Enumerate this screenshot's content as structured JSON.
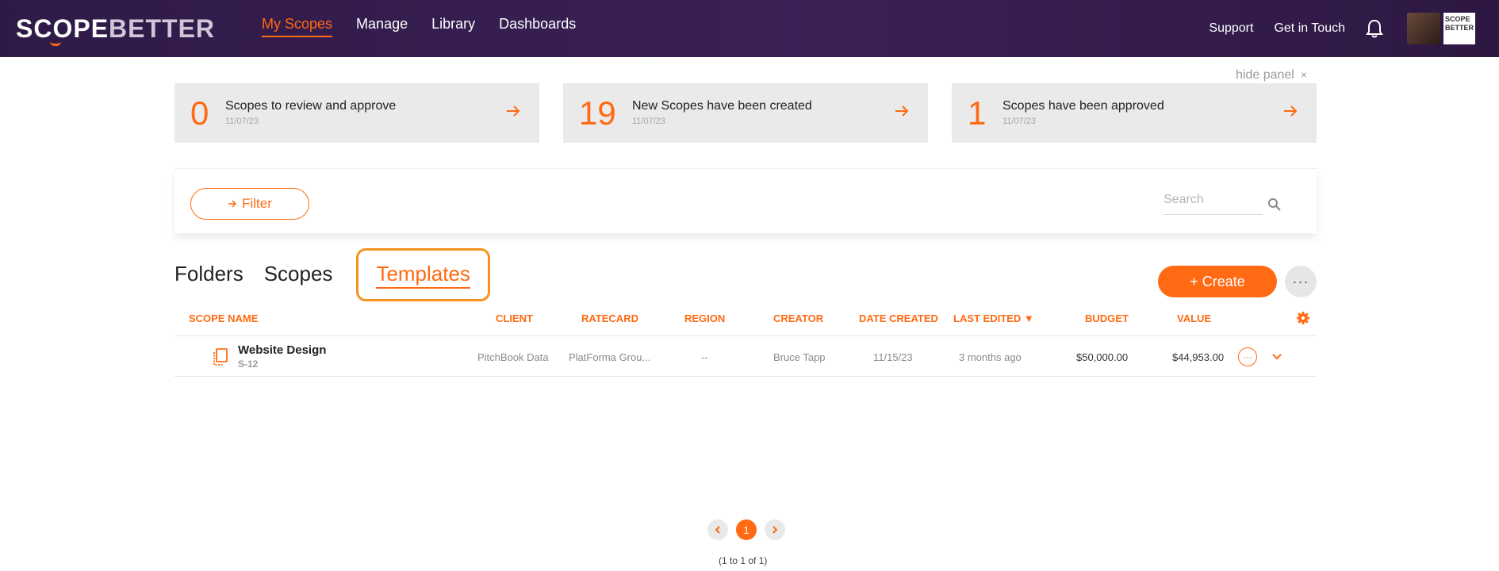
{
  "header": {
    "logo_scope": "SCOPE",
    "logo_better": "BETTER",
    "nav": [
      "My Scopes",
      "Manage",
      "Library",
      "Dashboards"
    ],
    "support": "Support",
    "get_in_touch": "Get in Touch",
    "mini_logo": "SCOPE BETTER"
  },
  "panel": {
    "hide_label": "hide panel",
    "close_glyph": "×",
    "cards": [
      {
        "count": "0",
        "text": "Scopes to review and approve",
        "date": "11/07/23"
      },
      {
        "count": "19",
        "text": "New Scopes have been created",
        "date": "11/07/23"
      },
      {
        "count": "1",
        "text": "Scopes have been approved",
        "date": "11/07/23"
      }
    ]
  },
  "filter": {
    "label": "Filter",
    "search_placeholder": "Search"
  },
  "tabs": {
    "folders": "Folders",
    "scopes": "Scopes",
    "templates": "Templates"
  },
  "actions": {
    "create": "+ Create",
    "more": "···"
  },
  "table": {
    "columns": {
      "scope_name": "SCOPE NAME",
      "client": "CLIENT",
      "ratecard": "RATECARD",
      "region": "REGION",
      "creator": "CREATOR",
      "date_created": "DATE CREATED",
      "last_edited": "LAST EDITED ▼",
      "budget": "BUDGET",
      "value": "VALUE"
    },
    "rows": [
      {
        "name": "Website Design",
        "id": "S-12",
        "client": "PitchBook Data",
        "ratecard": "PlatForma Grou...",
        "region": "--",
        "creator": "Bruce Tapp",
        "date_created": "11/15/23",
        "last_edited": "3 months ago",
        "budget": "$50,000.00",
        "value": "$44,953.00"
      }
    ]
  },
  "pagination": {
    "current": "1",
    "summary": "(1 to 1 of 1)"
  },
  "colors": {
    "accent": "#ff6a13",
    "highlight": "#f6921e",
    "nav_bg": "#3b2056"
  }
}
